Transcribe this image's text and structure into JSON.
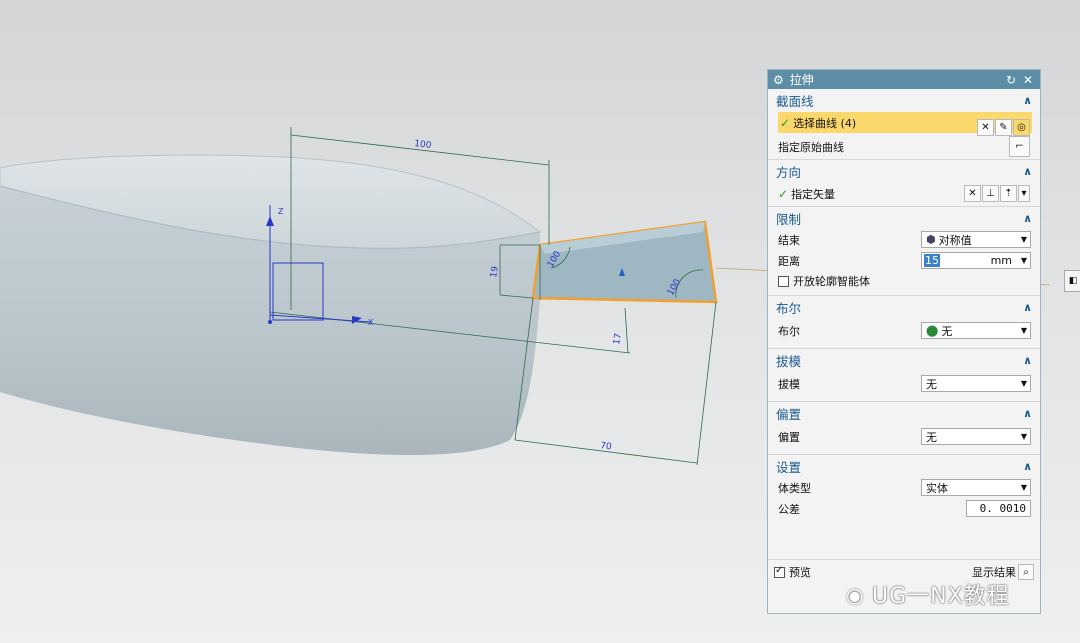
{
  "scene": {
    "dimensions": {
      "d1": "100",
      "d2": "19",
      "d3": "17",
      "d4": "70",
      "d5": "100",
      "d6": "100"
    },
    "axis_labels": {
      "z": "Z",
      "x": "X"
    }
  },
  "dialog": {
    "title": "拉伸",
    "sections": {
      "section_curve": {
        "title": "截面线",
        "select_curve_label": "选择曲线 (4)",
        "specify_origin_label": "指定原始曲线"
      },
      "direction": {
        "title": "方向",
        "specify_vector_label": "指定矢量"
      },
      "limits": {
        "title": "限制",
        "end_label": "结束",
        "end_value": "对称值",
        "distance_label": "距离",
        "distance_value": "15",
        "distance_unit": "mm",
        "open_profile_label": "开放轮廓智能体"
      },
      "boolean": {
        "title": "布尔",
        "label": "布尔",
        "value": "无"
      },
      "draft": {
        "title": "拔模",
        "label": "拔模",
        "value": "无"
      },
      "offset": {
        "title": "偏置",
        "label": "偏置",
        "value": "无"
      },
      "settings": {
        "title": "设置",
        "body_type_label": "体类型",
        "body_type_value": "实体",
        "tolerance_label": "公差",
        "tolerance_value": "0. 0010"
      }
    },
    "footer": {
      "preview_label": "预览",
      "show_result_label": "显示结果"
    }
  },
  "watermark": {
    "text": "UG一NX教程"
  },
  "colors": {
    "title_bar": "#5b8ea6",
    "section_title": "#1b5b8f",
    "selection_highlight": "#fbd86b",
    "profile_edge": "#f0a030"
  }
}
